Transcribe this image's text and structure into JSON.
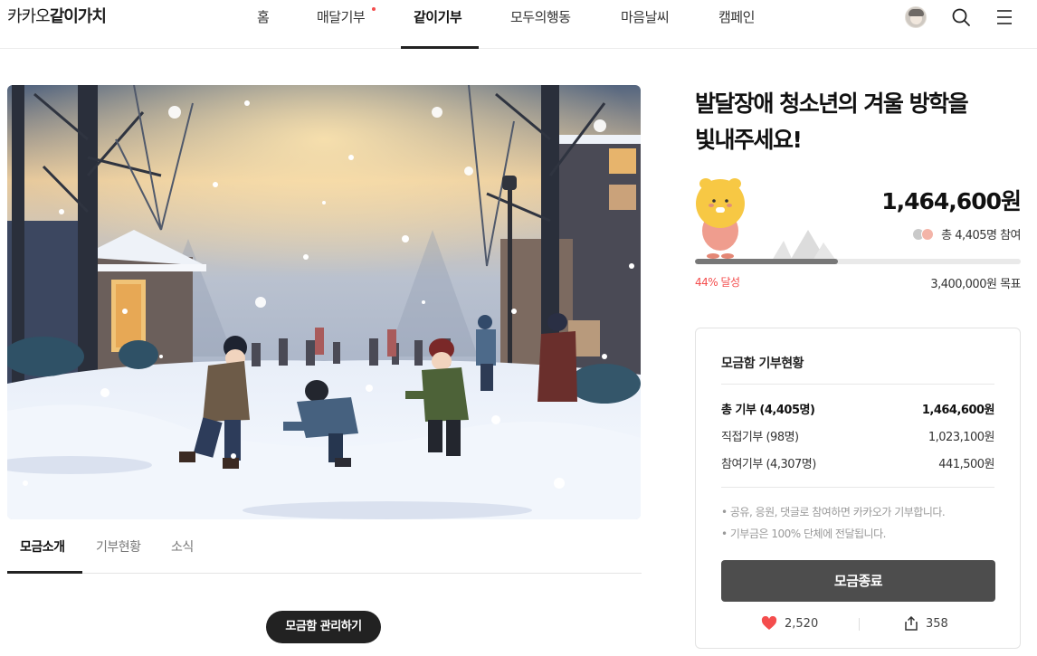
{
  "header": {
    "logo_light": "카카오",
    "logo_bold": "같이가치",
    "nav": [
      {
        "label": "홈"
      },
      {
        "label": "매달기부"
      },
      {
        "label": "같이기부"
      },
      {
        "label": "모두의행동"
      },
      {
        "label": "마음날씨"
      },
      {
        "label": "캠페인"
      }
    ],
    "active_nav": "같이기부"
  },
  "campaign": {
    "title_line1": "발달장애 청소년의 겨울 방학을",
    "title_line2": "빛내주세요!",
    "amount": "1,464,600원",
    "participants": "총 4,405명 참여",
    "progress_label": "44% 달성",
    "progress_percent": 44,
    "goal": "3,400,000원 목표"
  },
  "tabs": [
    {
      "label": "모금소개"
    },
    {
      "label": "기부현황"
    },
    {
      "label": "소식"
    }
  ],
  "manage_button": "모금함 관리하기",
  "status_box": {
    "title": "모금함 기부현황",
    "rows": [
      {
        "label": "총 기부 (4,405명)",
        "value": "1,464,600원"
      },
      {
        "label": "직접기부 (98명)",
        "value": "1,023,100원"
      },
      {
        "label": "참여기부 (4,307명)",
        "value": "441,500원"
      }
    ],
    "notes": [
      "• 공유, 응원, 댓글로 참여하면 카카오가 기부합니다.",
      "• 기부금은 100% 단체에 전달됩니다."
    ],
    "end_button": "모금종료",
    "likes": "2,520",
    "shares": "358"
  },
  "colors": {
    "accent_red": "#f44d4d",
    "dark_button": "#4d4d4d"
  }
}
